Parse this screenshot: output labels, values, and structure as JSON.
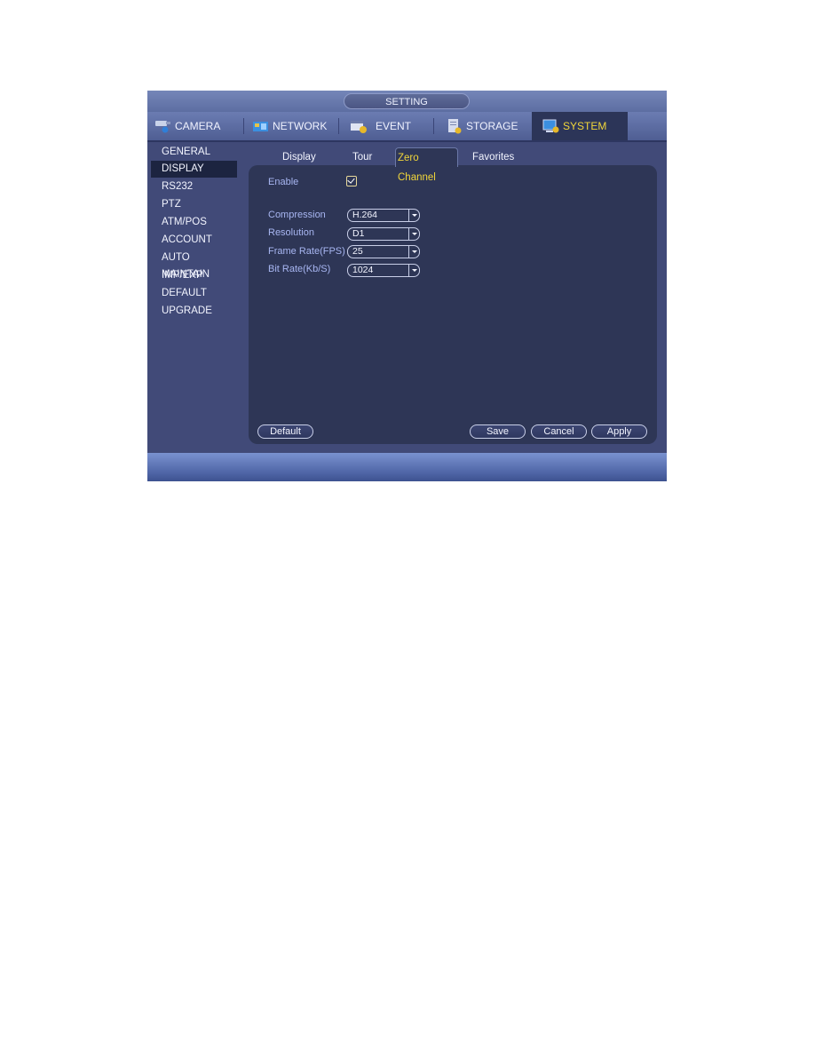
{
  "window": {
    "title": "SETTING"
  },
  "main_tabs": [
    {
      "label": "CAMERA",
      "icon": "camera-icon",
      "active": false
    },
    {
      "label": "NETWORK",
      "icon": "network-icon",
      "active": false
    },
    {
      "label": "EVENT",
      "icon": "event-icon",
      "active": false
    },
    {
      "label": "STORAGE",
      "icon": "storage-icon",
      "active": false
    },
    {
      "label": "SYSTEM",
      "icon": "system-icon",
      "active": true
    }
  ],
  "sidebar": {
    "items": [
      {
        "label": "GENERAL",
        "active": false
      },
      {
        "label": "DISPLAY",
        "active": true
      },
      {
        "label": "RS232",
        "active": false
      },
      {
        "label": "PTZ",
        "active": false
      },
      {
        "label": "ATM/POS",
        "active": false
      },
      {
        "label": "ACCOUNT",
        "active": false
      },
      {
        "label": "AUTO MAINTAIN",
        "active": false
      },
      {
        "label": "IMP/EXP",
        "active": false
      },
      {
        "label": "DEFAULT",
        "active": false
      },
      {
        "label": "UPGRADE",
        "active": false
      }
    ]
  },
  "sub_tabs": [
    {
      "label": "Display",
      "active": false
    },
    {
      "label": "Tour",
      "active": false
    },
    {
      "label": "Zero Channel",
      "active": true
    },
    {
      "label": "Favorites",
      "active": false
    }
  ],
  "form": {
    "enable": {
      "label": "Enable",
      "checked": true
    },
    "compression": {
      "label": "Compression",
      "value": "H.264"
    },
    "resolution": {
      "label": "Resolution",
      "value": "D1"
    },
    "frame_rate": {
      "label": "Frame Rate(FPS)",
      "value": "25"
    },
    "bit_rate": {
      "label": "Bit Rate(Kb/S)",
      "value": "1024"
    }
  },
  "buttons": {
    "default": "Default",
    "save": "Save",
    "cancel": "Cancel",
    "apply": "Apply"
  },
  "colors": {
    "active_text": "#f1d63a",
    "label_text": "#a8b6f2",
    "panel_bg": "#2e3656",
    "window_bg": "#414a78"
  }
}
